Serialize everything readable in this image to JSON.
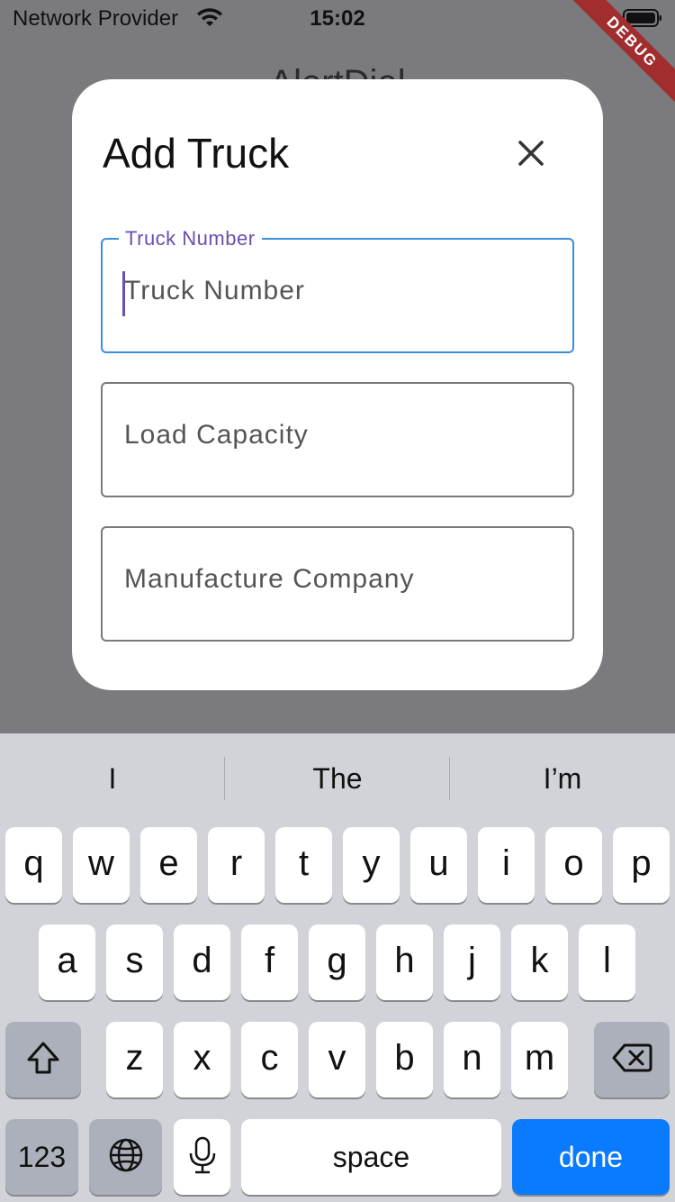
{
  "status_bar": {
    "carrier": "Network Provider",
    "time": "15:02",
    "debug_label": "DEBUG"
  },
  "background": {
    "title_partial": "AlertDial"
  },
  "dialog": {
    "title": "Add Truck",
    "close_icon": "close-icon",
    "fields": [
      {
        "label": "Truck Number",
        "placeholder": "Truck Number",
        "focused": true
      },
      {
        "label": "",
        "placeholder": "Load Capacity",
        "focused": false
      },
      {
        "label": "",
        "placeholder": "Manufacture Company",
        "focused": false
      }
    ]
  },
  "keyboard": {
    "suggestions": [
      "I",
      "The",
      "I’m"
    ],
    "row1": [
      "q",
      "w",
      "e",
      "r",
      "t",
      "y",
      "u",
      "i",
      "o",
      "p"
    ],
    "row2": [
      "a",
      "s",
      "d",
      "f",
      "g",
      "h",
      "j",
      "k",
      "l"
    ],
    "row3": [
      "z",
      "x",
      "c",
      "v",
      "b",
      "n",
      "m"
    ],
    "numbers_label": "123",
    "space_label": "space",
    "done_label": "done",
    "icons": {
      "shift": "shift-icon",
      "delete": "backspace-icon",
      "globe": "globe-icon",
      "mic": "microphone-icon"
    },
    "done_color": "#0A7AFF"
  }
}
